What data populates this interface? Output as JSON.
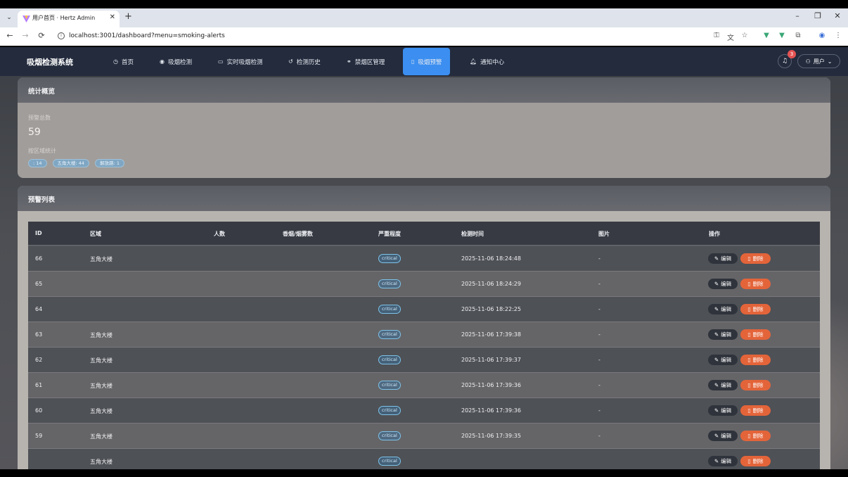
{
  "browser": {
    "tab_title": "用户首页 · Hertz Admin",
    "url": "localhost:3001/dashboard?menu=smoking-alerts",
    "new_tab": "+",
    "tab_close": "✕",
    "tab_list": "⌄",
    "window_buttons": [
      "–",
      "❐",
      "✕"
    ],
    "nav_buttons": [
      "←",
      "→",
      "⟳"
    ]
  },
  "navbar": {
    "brand": "吸烟检测系统",
    "items": [
      {
        "label": "首页",
        "icon": "home-icon"
      },
      {
        "label": "吸烟检测",
        "icon": "eye-icon"
      },
      {
        "label": "实时吸烟检测",
        "icon": "camera-icon"
      },
      {
        "label": "检测历史",
        "icon": "history-icon"
      },
      {
        "label": "禁烟区管理",
        "icon": "link-icon"
      },
      {
        "label": "吸烟预警",
        "icon": "document-icon",
        "active": true
      },
      {
        "label": "通知中心",
        "icon": "bell-icon"
      }
    ],
    "notification_count": "3",
    "user_label": "用户"
  },
  "stats": {
    "title": "统计概览",
    "total_label": "预警总数",
    "total_value": "59",
    "by_zone_label": "按区域统计",
    "zone_chips": [
      ": 14",
      "五角大楼: 44",
      "解放路: 1"
    ]
  },
  "alerts": {
    "title": "预警列表",
    "columns": [
      "ID",
      "区域",
      "人数",
      "香烟/烟雾数",
      "严重程度",
      "检测时间",
      "图片",
      "操作"
    ],
    "edit_label": "编辑",
    "delete_label": "删除",
    "rows": [
      {
        "id": "66",
        "zone": "五角大楼",
        "people": "",
        "count": "",
        "severity": "critical",
        "time": "2025-11-06 18:24:48",
        "image": "-"
      },
      {
        "id": "65",
        "zone": "",
        "people": "",
        "count": "",
        "severity": "critical",
        "time": "2025-11-06 18:24:29",
        "image": "-"
      },
      {
        "id": "64",
        "zone": "",
        "people": "",
        "count": "",
        "severity": "critical",
        "time": "2025-11-06 18:22:25",
        "image": "-"
      },
      {
        "id": "63",
        "zone": "五角大楼",
        "people": "",
        "count": "",
        "severity": "critical",
        "time": "2025-11-06 17:39:38",
        "image": "-"
      },
      {
        "id": "62",
        "zone": "五角大楼",
        "people": "",
        "count": "",
        "severity": "critical",
        "time": "2025-11-06 17:39:37",
        "image": "-"
      },
      {
        "id": "61",
        "zone": "五角大楼",
        "people": "",
        "count": "",
        "severity": "critical",
        "time": "2025-11-06 17:39:36",
        "image": "-"
      },
      {
        "id": "60",
        "zone": "五角大楼",
        "people": "",
        "count": "",
        "severity": "critical",
        "time": "2025-11-06 17:39:36",
        "image": "-"
      },
      {
        "id": "59",
        "zone": "五角大楼",
        "people": "",
        "count": "",
        "severity": "critical",
        "time": "2025-11-06 17:39:35",
        "image": "-"
      },
      {
        "id": "",
        "zone": "五角大楼",
        "people": "",
        "count": "",
        "severity": "critical",
        "time": "",
        "image": ""
      }
    ]
  }
}
